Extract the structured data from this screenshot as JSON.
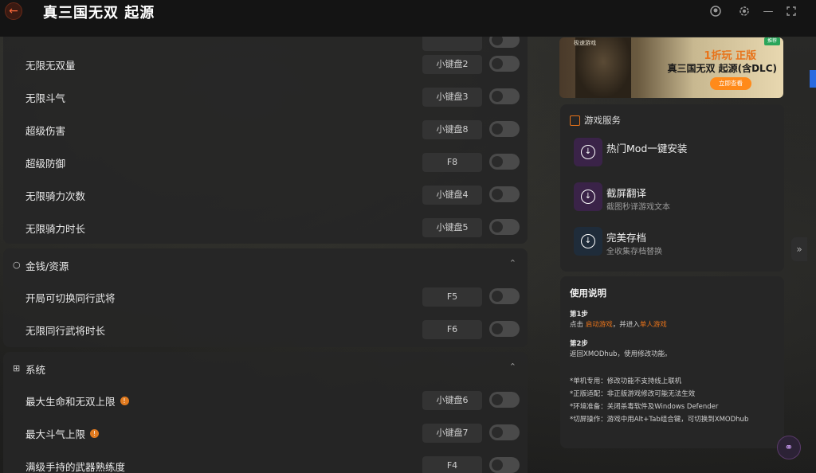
{
  "titlebar": {
    "back_icon": "arrow-left-icon",
    "title": "真三国无双 起源",
    "accent": "#ff6a3a"
  },
  "sections": {
    "top": {
      "rows": [
        {
          "label": "无限无双量",
          "key": "小键盘2",
          "enabled": false
        },
        {
          "label": "无限斗气",
          "key": "小键盘3",
          "enabled": false
        },
        {
          "label": "超级伤害",
          "key": "小键盘8",
          "enabled": false
        },
        {
          "label": "超级防御",
          "key": "F8",
          "enabled": false
        },
        {
          "label": "无限骑力次数",
          "key": "小键盘4",
          "enabled": false
        },
        {
          "label": "无限骑力时长",
          "key": "小键盘5",
          "enabled": false
        }
      ]
    },
    "money": {
      "title": "金钱/资源",
      "rows": [
        {
          "label": "开局可切换同行武将",
          "key": "F5",
          "enabled": false
        },
        {
          "label": "无限同行武将时长",
          "key": "F6",
          "enabled": false
        }
      ]
    },
    "system": {
      "title": "系统",
      "rows": [
        {
          "label": "最大生命和无双上限",
          "key": "小键盘6",
          "enabled": false,
          "info": true
        },
        {
          "label": "最大斗气上限",
          "key": "小键盘7",
          "enabled": false,
          "info": true
        },
        {
          "label": "满级手持的武器熟练度",
          "key": "F4",
          "enabled": false
        }
      ]
    }
  },
  "banner": {
    "corner_small": "极速游戏",
    "badge": "推荐",
    "promo_line1_a": "1折玩",
    "promo_line1_b": "正版",
    "promo_line2": "真三国无双 起源(含DLC)",
    "cta": "立即查看"
  },
  "services": {
    "title": "游戏服务",
    "items": [
      {
        "title": "热门Mod一键安装",
        "subtitle": "",
        "color": "#3a2348"
      },
      {
        "title": "截屏翻译",
        "subtitle": "截图秒译游戏文本",
        "color": "#3a2348"
      },
      {
        "title": "完美存档",
        "subtitle": "全收集存档替换",
        "color": "#1f2c3a"
      }
    ]
  },
  "guide": {
    "title": "使用说明",
    "step1_title": "第1步",
    "step1_a": "点击 ",
    "step1_link1": "启动游戏",
    "step1_b": "，并进入",
    "step1_link2": "单人游戏",
    "step2_title": "第2步",
    "step2_text": "返回XMODhub，使用修改功能。",
    "notes": [
      "*单机专用：修改功能不支持线上联机",
      "*正版适配：非正版游戏修改可能无法生效",
      "*环境准备：关闭杀毒软件及Windows Defender",
      "*切屏操作：游戏中用Alt+Tab组合键，可切换到XMODhub"
    ]
  }
}
